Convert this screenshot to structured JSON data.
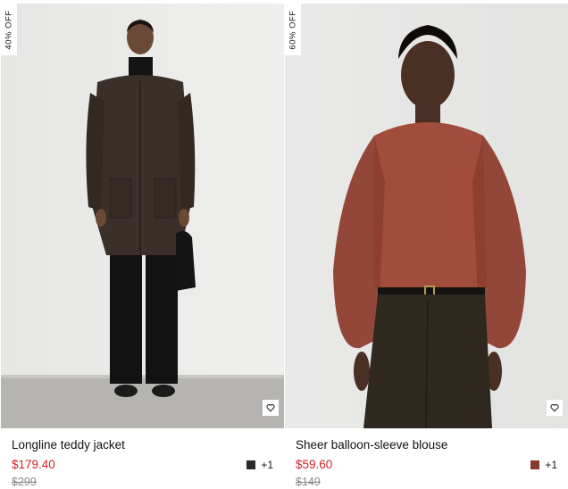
{
  "products": [
    {
      "badge": "40% OFF",
      "name": "Longline teddy jacket",
      "price": "$179.40",
      "original_price": "$299",
      "swatch_color": "#2d2a28",
      "more_colors": "+1",
      "wishlist_icon": "heart-icon"
    },
    {
      "badge": "60% OFF",
      "name": "Sheer balloon-sleeve blouse",
      "price": "$59.60",
      "original_price": "$149",
      "swatch_color": "#8a3a2a",
      "more_colors": "+1",
      "wishlist_icon": "heart-icon"
    }
  ],
  "colors": {
    "sale_price": "#d4202c",
    "original_price": "#8a8a8a"
  }
}
